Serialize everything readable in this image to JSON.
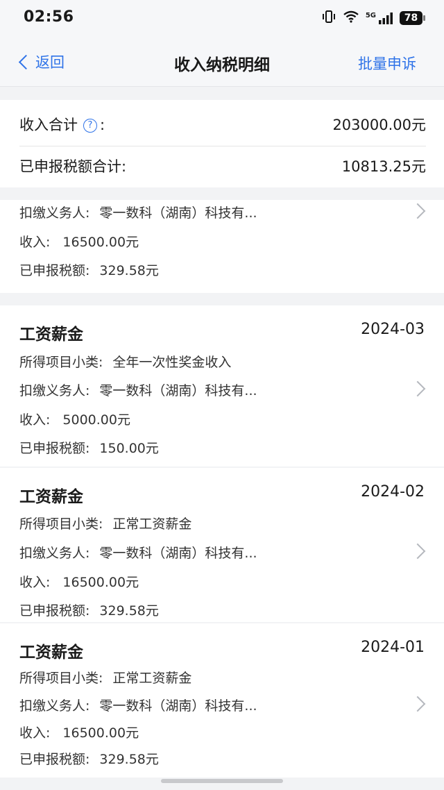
{
  "status": {
    "time": "02:56",
    "network": "5G",
    "battery": "78"
  },
  "nav": {
    "back_label": "返回",
    "title": "收入纳税明细",
    "batch_appeal": "批量申诉"
  },
  "summary": {
    "income_total_label": "收入合计",
    "income_total_colon": ":",
    "income_total_value": "203000.00元",
    "tax_total_label": "已申报税额合计:",
    "tax_total_value": "10813.25元"
  },
  "labels": {
    "subcategory": "所得项目小类:",
    "withholder": "扣缴义务人:",
    "income": "收入:",
    "tax": "已申报税额:"
  },
  "records": [
    {
      "withholder": "零一数科（湖南）科技有...",
      "income": "16500.00元",
      "tax": "329.58元"
    },
    {
      "title": "工资薪金",
      "date": "2024-03",
      "subcategory": "全年一次性奖金收入",
      "withholder": "零一数科（湖南）科技有...",
      "income": "5000.00元",
      "tax": "150.00元"
    },
    {
      "title": "工资薪金",
      "date": "2024-02",
      "subcategory": "正常工资薪金",
      "withholder": "零一数科（湖南）科技有...",
      "income": "16500.00元",
      "tax": "329.58元"
    },
    {
      "title": "工资薪金",
      "date": "2024-01",
      "subcategory": "正常工资薪金",
      "withholder": "零一数科（湖南）科技有...",
      "income": "16500.00元",
      "tax": "329.58元"
    }
  ],
  "colors": {
    "accent": "#2f73e8",
    "background": "#f2f3f5",
    "card": "#ffffff"
  }
}
